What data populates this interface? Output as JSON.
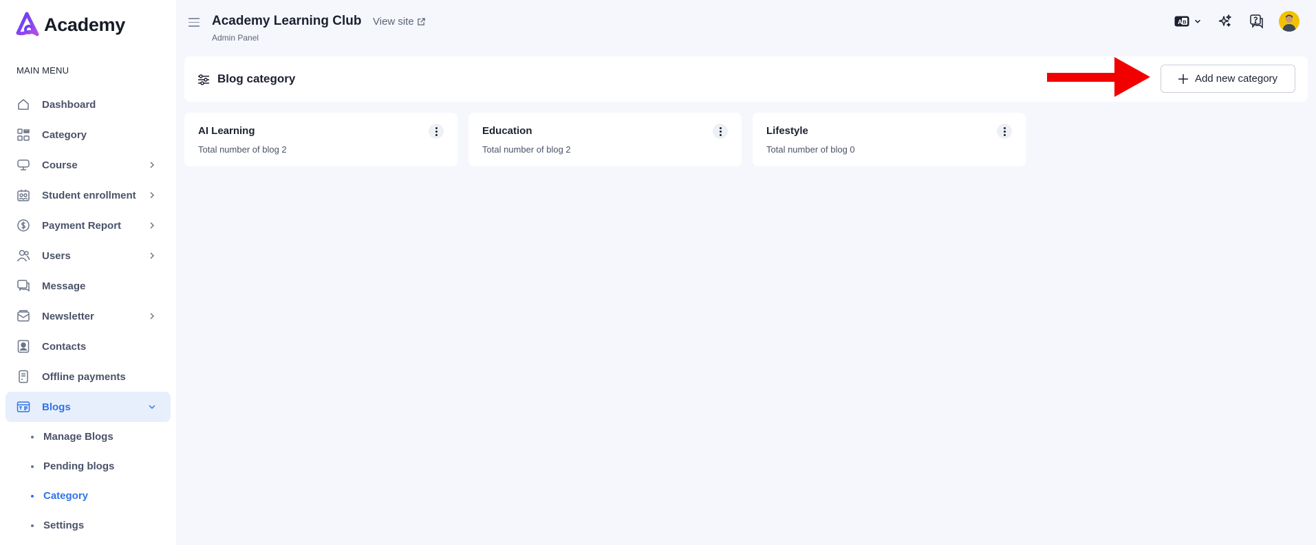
{
  "brand": {
    "name": "Academy",
    "accent": "#2f74e8",
    "logo_gradient": [
      "#5b3df5",
      "#b14de8"
    ]
  },
  "sidebar": {
    "menu_title": "MAIN MENU",
    "items": [
      {
        "label": "Dashboard",
        "icon": "home-icon",
        "expandable": false
      },
      {
        "label": "Category",
        "icon": "grid-icon",
        "expandable": false
      },
      {
        "label": "Course",
        "icon": "presentation-icon",
        "expandable": true
      },
      {
        "label": "Student enrollment",
        "icon": "enrollment-icon",
        "expandable": true
      },
      {
        "label": "Payment Report",
        "icon": "dollar-icon",
        "expandable": true
      },
      {
        "label": "Users",
        "icon": "users-icon",
        "expandable": true
      },
      {
        "label": "Message",
        "icon": "chat-icon",
        "expandable": false
      },
      {
        "label": "Newsletter",
        "icon": "mail-open-icon",
        "expandable": true
      },
      {
        "label": "Contacts",
        "icon": "contact-icon",
        "expandable": false
      },
      {
        "label": "Offline payments",
        "icon": "receipt-icon",
        "expandable": false
      },
      {
        "label": "Blogs",
        "icon": "blog-icon",
        "expandable": true,
        "active": true
      }
    ],
    "blog_submenu": [
      {
        "label": "Manage Blogs"
      },
      {
        "label": "Pending blogs"
      },
      {
        "label": "Category",
        "active": true
      },
      {
        "label": "Settings"
      }
    ]
  },
  "header": {
    "title": "Academy Learning Club",
    "subtitle": "Admin Panel",
    "view_site": "View site"
  },
  "page": {
    "title": "Blog category",
    "add_button": "Add new category"
  },
  "categories": [
    {
      "name": "AI Learning",
      "count_text": "Total number of blog 2"
    },
    {
      "name": "Education",
      "count_text": "Total number of blog 2"
    },
    {
      "name": "Lifestyle",
      "count_text": "Total number of blog 0"
    }
  ],
  "annotation": {
    "arrow_color": "#f20000"
  }
}
